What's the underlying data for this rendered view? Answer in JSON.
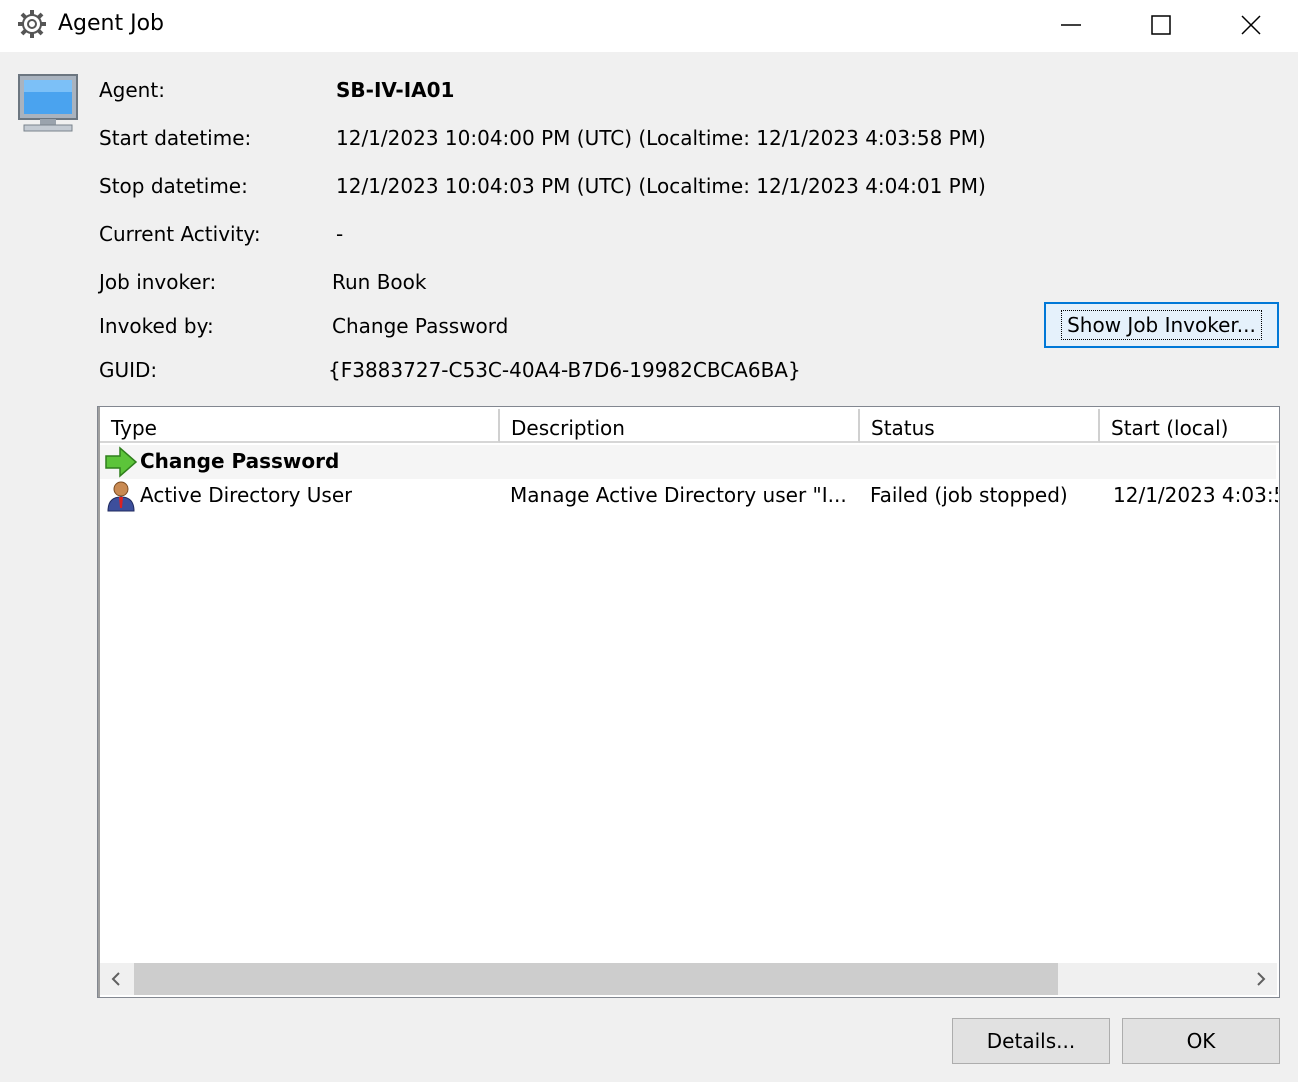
{
  "window": {
    "title": "Agent Job",
    "minimize_label": "Minimize",
    "maximize_label": "Maximize",
    "close_label": "Close"
  },
  "info": {
    "agent_label": "Agent:",
    "agent_value": "SB-IV-IA01",
    "start_label": "Start datetime:",
    "start_value": "12/1/2023 10:04:00 PM (UTC)  (Localtime: 12/1/2023 4:03:58 PM)",
    "stop_label": "Stop datetime:",
    "stop_value": "12/1/2023 10:04:03 PM (UTC)  (Localtime: 12/1/2023 4:04:01 PM)",
    "activity_label": "Current Activity:",
    "activity_value": "-",
    "invoker_label": "Job invoker:",
    "invoker_value": "Run Book",
    "invoked_by_label": "Invoked by:",
    "invoked_by_value": "Change Password",
    "guid_label": "GUID:",
    "guid_value": "{F3883727-C53C-40A4-B7D6-19982CBCA6BA}"
  },
  "show_invoker_button": "Show Job Invoker...",
  "list": {
    "columns": [
      "Type",
      "Description",
      "Status",
      "Start (local)"
    ],
    "group": {
      "label": "Change Password",
      "icon": "green-arrow-icon"
    },
    "rows": [
      {
        "icon": "ad-user-icon",
        "type": "Active Directory User",
        "description": "Manage Active Directory user \"I...",
        "status": "Failed (job stopped)",
        "start": "12/1/2023 4:03:5"
      }
    ]
  },
  "buttons": {
    "details": "Details...",
    "ok": "OK"
  }
}
